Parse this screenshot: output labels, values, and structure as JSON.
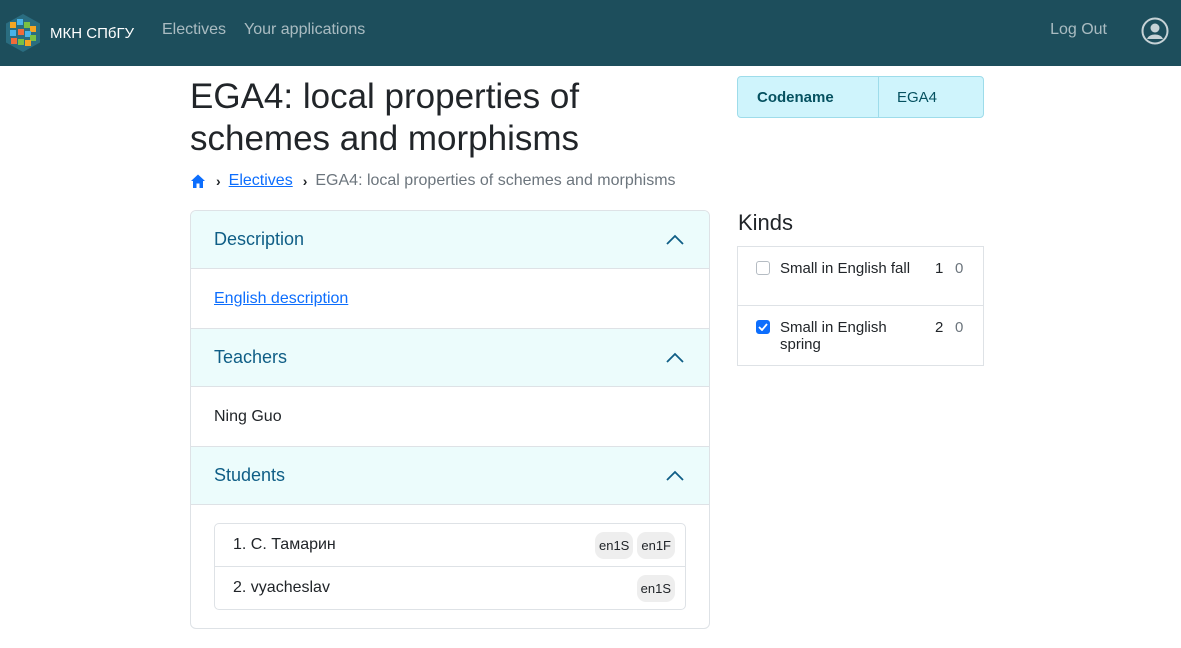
{
  "navbar": {
    "brand": "МКН СПбГУ",
    "links": [
      "Electives",
      "Your applications"
    ],
    "logout": "Log Out"
  },
  "page": {
    "title": "EGA4: local properties of schemes and morphisms"
  },
  "breadcrumb": {
    "home_icon": "home-icon",
    "electives": "Electives",
    "current": "EGA4: local properties of schemes and morphisms"
  },
  "sections": {
    "description": {
      "header": "Description",
      "link": "English description"
    },
    "teachers": {
      "header": "Teachers",
      "names": [
        "Ning Guo"
      ]
    },
    "students": {
      "header": "Students",
      "rows": [
        {
          "name": "1. С. Тамарин",
          "badges": [
            "en1S",
            "en1F"
          ]
        },
        {
          "name": "2. vyacheslav",
          "badges": [
            "en1S"
          ]
        }
      ]
    }
  },
  "info": {
    "key": "Codename",
    "value": "EGA4"
  },
  "kinds": {
    "title": "Kinds",
    "items": [
      {
        "label": "Small in English fall",
        "count": "1",
        "other": "0",
        "checked": false
      },
      {
        "label": "Small in English spring",
        "count": "2",
        "other": "0",
        "checked": true
      }
    ]
  },
  "colors": {
    "navbar": "#1d4e5c",
    "accordion_header": "#ecfcfc",
    "accent": "#0d6efd"
  }
}
